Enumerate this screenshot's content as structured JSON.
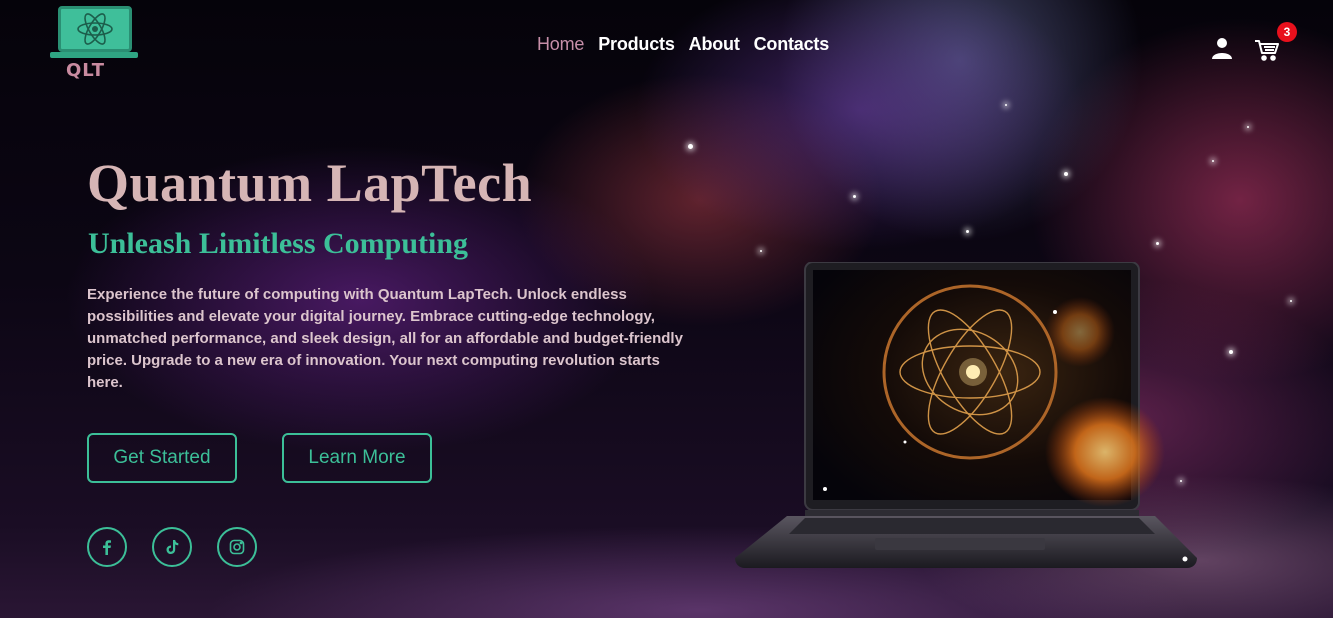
{
  "brand": {
    "logo_text": "QLT"
  },
  "nav": {
    "items": [
      {
        "label": "Home",
        "active": true
      },
      {
        "label": "Products",
        "active": false
      },
      {
        "label": "About",
        "active": false
      },
      {
        "label": "Contacts",
        "active": false
      }
    ]
  },
  "header": {
    "user_icon": "user-icon",
    "cart_icon": "cart-icon",
    "cart_count": "3"
  },
  "hero": {
    "title": "Quantum LapTech",
    "subtitle": "Unleash Limitless Computing",
    "description": "Experience the future of computing with Quantum LapTech. Unlock endless possibilities and elevate your digital journey. Embrace cutting-edge technology, unmatched performance, and sleek design, all for an affordable and budget-friendly price. Upgrade to a new era of innovation. Your next computing revolution starts here.",
    "primary_button": "Get Started",
    "secondary_button": "Learn More"
  },
  "social": [
    {
      "icon": "facebook-icon"
    },
    {
      "icon": "tiktok-icon"
    },
    {
      "icon": "instagram-icon"
    }
  ],
  "colors": {
    "accent": "#3cbf98",
    "nav_active": "#c78fa9",
    "title": "#d6b5b5",
    "badge": "#e8101c"
  }
}
